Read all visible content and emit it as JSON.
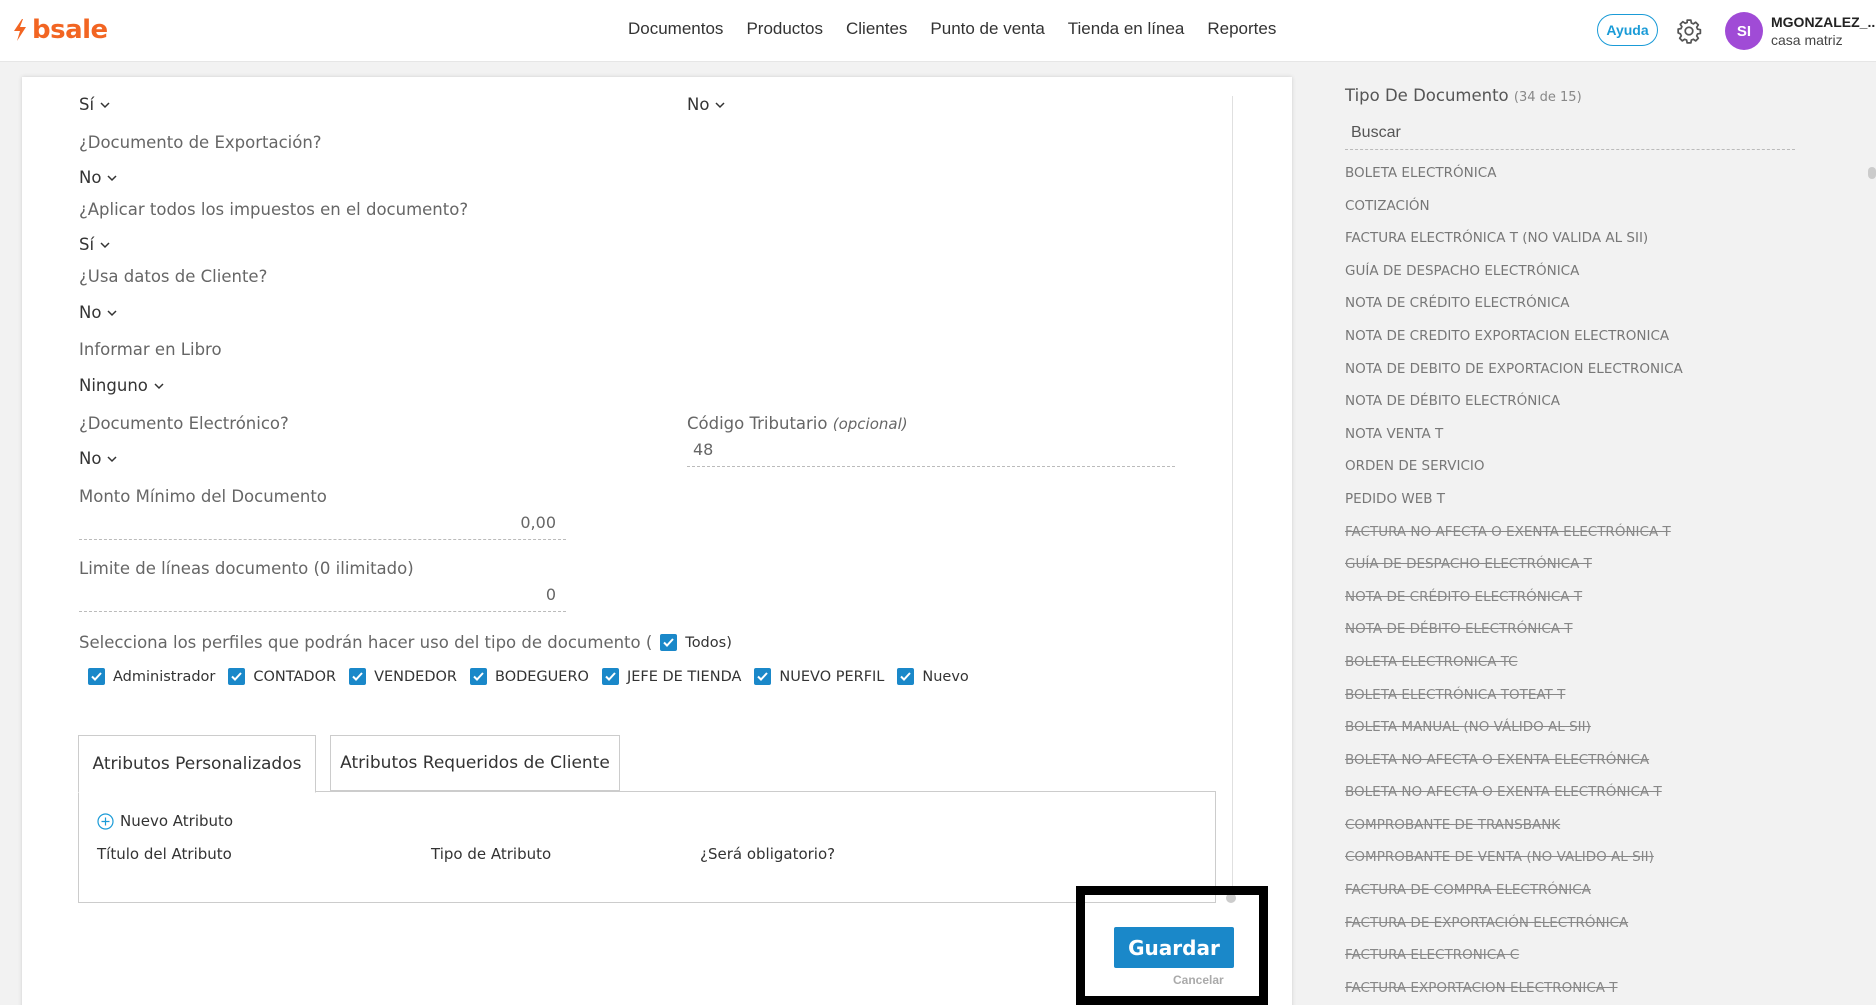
{
  "topbar": {
    "logo_text": "bsale",
    "nav": [
      "Documentos",
      "Productos",
      "Clientes",
      "Punto de venta",
      "Tienda en línea",
      "Reportes"
    ],
    "help_label": "Ayuda",
    "avatar_initials": "SI",
    "user_name": "MGONZALEZ_...",
    "user_branch": "casa matriz",
    "colors": {
      "brand": "#f26522",
      "accent": "#1a9bd7",
      "avatar": "#a04bd6"
    }
  },
  "form": {
    "top_left_value": "Sí",
    "top_right_value": "No",
    "export_label": "¿Documento de Exportación?",
    "export_value": "No",
    "all_taxes_label": "¿Aplicar todos los impuestos en el documento?",
    "all_taxes_value": "Sí",
    "client_data_label": "¿Usa datos de Cliente?",
    "client_data_value": "No",
    "book_label": "Informar en Libro",
    "book_value": "Ninguno",
    "electronic_label": "¿Documento Electrónico?",
    "electronic_value": "No",
    "tax_code_label": "Código Tributario",
    "tax_code_optional": "(opcional)",
    "tax_code_value": "48",
    "min_amount_label": "Monto Mínimo del Documento",
    "min_amount_value": "0,00",
    "line_limit_label": "Limite de líneas documento (0 ilimitado)",
    "line_limit_value": "0",
    "profiles_label": "Selecciona los perfiles que podrán hacer uso del tipo de documento (",
    "profiles_all_label": "Todos)",
    "profiles": [
      "Administrador",
      "CONTADOR",
      "VENDEDOR",
      "BODEGUERO",
      "JEFE DE TIENDA",
      "NUEVO PERFIL",
      "Nuevo"
    ]
  },
  "tabs": {
    "custom": "Atributos Personalizados",
    "client_required": "Atributos Requeridos de Cliente"
  },
  "attributes": {
    "new_label": "Nuevo Atributo",
    "col_title": "Título del Atributo",
    "col_type": "Tipo de Atributo",
    "col_required": "¿Será obligatorio?"
  },
  "actions": {
    "save": "Guardar",
    "cancel": "Cancelar"
  },
  "doc_types": {
    "title": "Tipo De Documento",
    "count": "(34 de 15)",
    "search_placeholder": "Buscar",
    "items": [
      {
        "label": "BOLETA ELECTRÓNICA",
        "strike": false
      },
      {
        "label": "COTIZACIÓN",
        "strike": false
      },
      {
        "label": "FACTURA ELECTRÓNICA T (NO VALIDA AL SII)",
        "strike": false
      },
      {
        "label": "GUÍA DE DESPACHO ELECTRÓNICA",
        "strike": false
      },
      {
        "label": "NOTA DE CRÉDITO ELECTRÓNICA",
        "strike": false
      },
      {
        "label": "NOTA DE CREDITO EXPORTACION ELECTRONICA",
        "strike": false
      },
      {
        "label": "NOTA DE DEBITO DE EXPORTACION ELECTRONICA",
        "strike": false
      },
      {
        "label": "NOTA DE DÉBITO ELECTRÓNICA",
        "strike": false
      },
      {
        "label": "NOTA VENTA T",
        "strike": false
      },
      {
        "label": "ORDEN DE SERVICIO",
        "strike": false
      },
      {
        "label": "PEDIDO WEB T",
        "strike": false
      },
      {
        "label": "FACTURA NO AFECTA O EXENTA ELECTRÓNICA T",
        "strike": true
      },
      {
        "label": "GUÍA DE DESPACHO ELECTRÓNICA T",
        "strike": true
      },
      {
        "label": "NOTA DE CRÉDITO ELECTRÓNICA T",
        "strike": true
      },
      {
        "label": "NOTA DE DÉBITO ELECTRÓNICA T",
        "strike": true
      },
      {
        "label": "BOLETA ELECTRONICA TC",
        "strike": true
      },
      {
        "label": "BOLETA ELECTRÓNICA TOTEAT T",
        "strike": true
      },
      {
        "label": "BOLETA MANUAL (NO VÁLIDO AL SII)",
        "strike": true
      },
      {
        "label": "BOLETA NO AFECTA O EXENTA ELECTRÓNICA",
        "strike": true
      },
      {
        "label": "BOLETA NO AFECTA O EXENTA ELECTRÓNICA T",
        "strike": true
      },
      {
        "label": "COMPROBANTE DE TRANSBANK",
        "strike": true
      },
      {
        "label": "COMPROBANTE DE VENTA (NO VALIDO AL SII)",
        "strike": true
      },
      {
        "label": "FACTURA DE COMPRA ELECTRÓNICA",
        "strike": true
      },
      {
        "label": "FACTURA DE EXPORTACIÓN ELECTRÓNICA",
        "strike": true
      },
      {
        "label": "FACTURA ELECTRONICA C",
        "strike": true
      },
      {
        "label": "FACTURA EXPORTACION ELECTRONICA T",
        "strike": true
      }
    ]
  }
}
